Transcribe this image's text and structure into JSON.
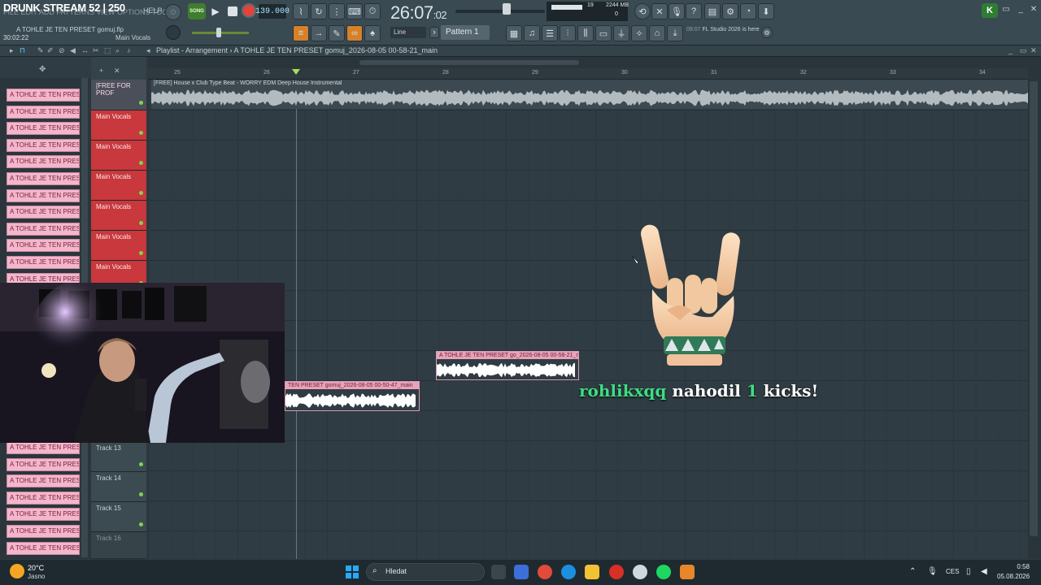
{
  "stream": {
    "title": "DRUNK STREAM 52 | 250"
  },
  "menu": {
    "ghost_text": "FILE EDIT ADD PATTERNS VIEW OPTIONS TOOLS",
    "help": "HELP"
  },
  "toolbar": {
    "project_file": "A TOHLE JE TEN PRESET gomuj.flp",
    "elapsed": "30:02:22",
    "hint_label": "Main Vocals",
    "song_mode": "SONG",
    "tempo": "139.000",
    "time_main": "26:07",
    "time_sub": ":02",
    "cpu": "19",
    "memory": "2244 MB",
    "polyphony": "0",
    "snap": "Line",
    "pattern": "Pattern 1",
    "news_time": "09:07",
    "news_text": "FL Studio 2026 is here",
    "ok_label": "K"
  },
  "playlist": {
    "path": "Playlist - Arrangement › A TOHLE JE TEN PRESET gomuj_2026-08-05 00-58-21_main",
    "bars": [
      "25",
      "26",
      "27",
      "28",
      "29",
      "30",
      "31",
      "32",
      "33",
      "34"
    ]
  },
  "picker": {
    "items": [
      "A TOHLE JE TEN PRESET g",
      "A TOHLE JE TEN PRESET g",
      "A TOHLE JE TEN PRESET g",
      "A TOHLE JE TEN PRESET g",
      "A TOHLE JE TEN PRESET g",
      "A TOHLE JE TEN PRESET g",
      "A TOHLE JE TEN PRESET g",
      "A TOHLE JE TEN PRESET g",
      "A TOHLE JE TEN PRESET g",
      "A TOHLE JE TEN PRESET g",
      "A TOHLE JE TEN PRESET g",
      "A TOHLE JE TEN PRESET g",
      "A TOHLE JE TEN PRESET g"
    ],
    "items_bottom": [
      "A TOHLE JE TEN PRESET g",
      "A TOHLE JE TEN PRESET g",
      "A TOHLE JE TEN PRESET g",
      "A TOHLE JE TEN PRESET g",
      "A TOHLE JE TEN PRESET g",
      "A TOHLE JE TEN PRESET g",
      "A TOHLE JE TEN PRESET g"
    ]
  },
  "tracks": {
    "t1": "[FREE FOR PROF",
    "t2": "Main Vocals",
    "t3": "Main Vocals",
    "t4": "Main Vocals",
    "t5": "Main Vocals",
    "t6": "Main Vocals",
    "t7": "Main Vocals",
    "t13": "Track 13",
    "t14": "Track 14",
    "t15": "Track 15",
    "t16": "Track 16"
  },
  "clips": {
    "beat": "[FREE] House x Club Type Beat - WORRY  EDM Deep House Instrumental",
    "vocal_a": "A TOHLE JE TEN PRESET go_2026-08-05 00-58-21_main",
    "vocal_b": "TEN PRESET gomuj_2026-08-05 00-50-47_main"
  },
  "alert": {
    "user": "rohlikxqq",
    "action": "nahodil",
    "amount": "1",
    "item": "kicks!"
  },
  "taskbar": {
    "temperature": "20°C",
    "weather": "Jasno",
    "search_label": "Hledat",
    "language": "CES",
    "time": "0:58",
    "date": "05.08.2026"
  },
  "colors": {
    "accent_green": "#3ddc84",
    "clip_pink": "#f3b6cb",
    "track_red": "#c8383c",
    "record_red": "#e0443a"
  }
}
